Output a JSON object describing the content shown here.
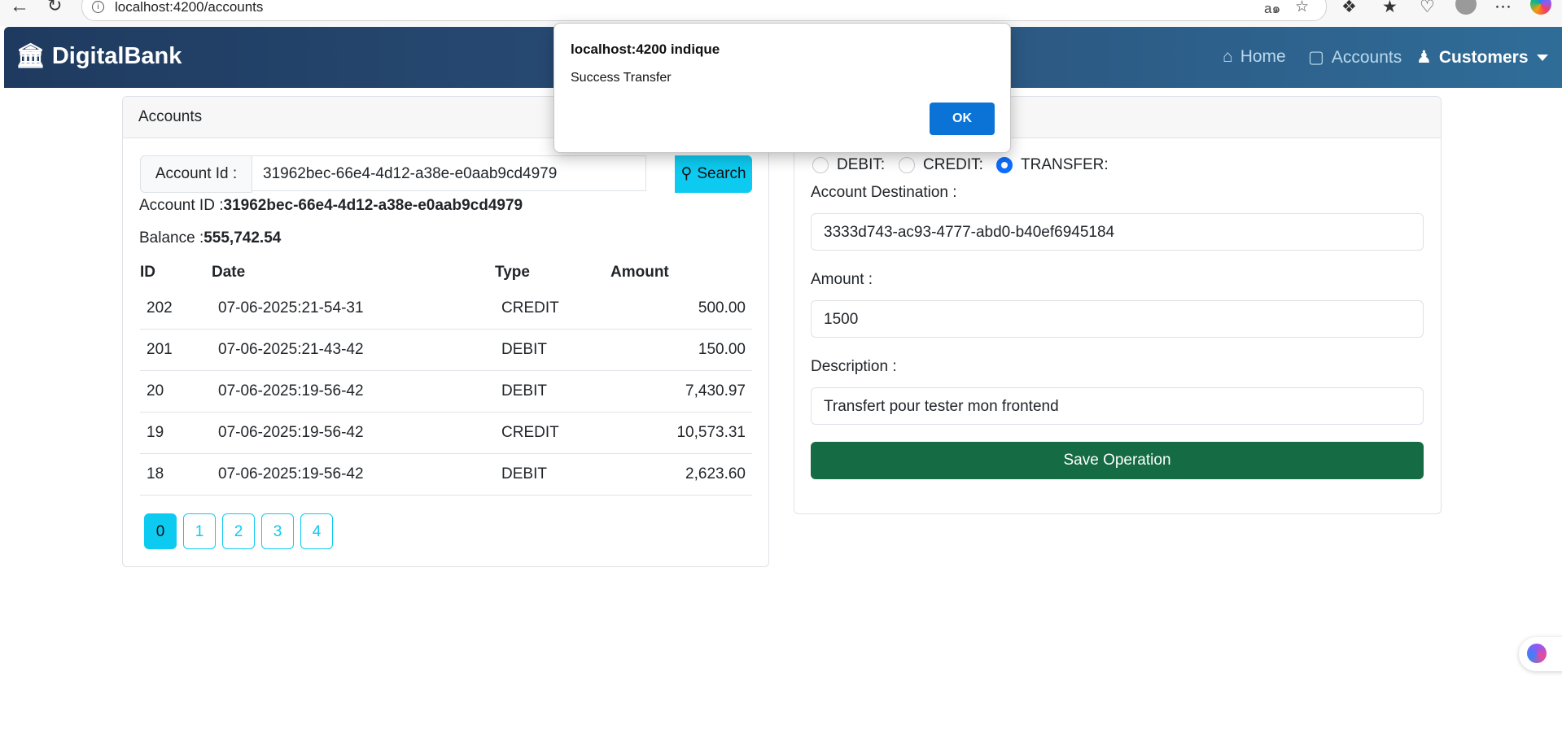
{
  "browser": {
    "url": "localhost:4200/accounts",
    "icons": [
      "back-icon",
      "reload-icon",
      "info-icon",
      "read-aloud-icon",
      "favorite-icon",
      "extensions-icon",
      "favorites-icon",
      "health-icon",
      "profile-icon",
      "more-icon",
      "copilot-icon"
    ]
  },
  "navbar": {
    "brand": "DigitalBank",
    "links": {
      "home": "Home",
      "accounts": "Accounts",
      "customers": "Customers"
    }
  },
  "accounts_card": {
    "header": "Accounts",
    "search_label": "Account Id :",
    "search_value": "31962bec-66e4-4d12-a38e-e0aab9cd4979",
    "search_button": "Search",
    "account_id_label": "Account ID :",
    "account_id_value": "31962bec-66e4-4d12-a38e-e0aab9cd4979",
    "balance_label": "Balance :",
    "balance_value": "555,742.54",
    "columns": [
      "ID",
      "Date",
      "Type",
      "Amount"
    ],
    "rows": [
      {
        "id": "202",
        "date": "07-06-2025:21-54-31",
        "type": "CREDIT",
        "amount": "500.00"
      },
      {
        "id": "201",
        "date": "07-06-2025:21-43-42",
        "type": "DEBIT",
        "amount": "150.00"
      },
      {
        "id": "20",
        "date": "07-06-2025:19-56-42",
        "type": "DEBIT",
        "amount": "7,430.97"
      },
      {
        "id": "19",
        "date": "07-06-2025:19-56-42",
        "type": "CREDIT",
        "amount": "10,573.31"
      },
      {
        "id": "18",
        "date": "07-06-2025:19-56-42",
        "type": "DEBIT",
        "amount": "2,623.60"
      }
    ],
    "pages": [
      "0",
      "1",
      "2",
      "3",
      "4"
    ],
    "active_page": "0"
  },
  "operations_card": {
    "radios": {
      "debit": "DEBIT:",
      "credit": "CREDIT:",
      "transfer": "TRANSFER:"
    },
    "selected": "TRANSFER",
    "destination_label": "Account Destination :",
    "destination_value": "3333d743-ac93-4777-abd0-b40ef6945184",
    "amount_label": "Amount :",
    "amount_value": "1500",
    "description_label": "Description :",
    "description_value": "Transfert pour tester mon frontend",
    "save_button": "Save Operation"
  },
  "dialog": {
    "title": "localhost:4200 indique",
    "message": "Success Transfer",
    "ok": "OK"
  },
  "colors": {
    "navbar_start": "#1f3a5f",
    "navbar_end": "#2f6d98",
    "info": "#0dcaf0",
    "success": "#156b44",
    "dialog_button": "#0b72d6",
    "radio_checked": "#0d6efd"
  }
}
